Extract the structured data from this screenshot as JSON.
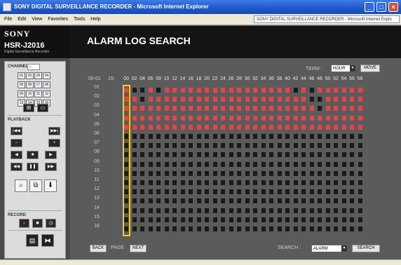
{
  "window": {
    "title": "SONY DIGITAL SURVEILLANCE RECORDER - Microsoft Internet Explorer",
    "url": "SONY DIGITAL SURVEILLANCE RECORDER - Microsoft Internet Explo"
  },
  "menu": [
    "File",
    "Edit",
    "View",
    "Favorites",
    "Tools",
    "Help"
  ],
  "brand": {
    "logo": "SONY",
    "model": "HSR-J2016",
    "subtitle": "Digital Surveillance Recorder"
  },
  "sidebar": {
    "channel_label": "CHANNEL",
    "channel_select": "--",
    "channels": [
      "01",
      "02",
      "03",
      "04",
      "05",
      "06",
      "07",
      "08",
      "09",
      "10",
      "11",
      "12",
      "13",
      "14",
      "15",
      "16"
    ],
    "active_channel": "07",
    "playback_label": "PLAYBACK",
    "record_label": "RECORD",
    "playback_buttons": [
      {
        "name": "skip-back-button",
        "glyph": "|◀◀"
      },
      {
        "name": "skip-forward-button",
        "glyph": "▶▶|"
      },
      {
        "name": "minus-button",
        "glyph": "−"
      },
      {
        "name": "plus-button",
        "glyph": "+"
      },
      {
        "name": "rewind-button",
        "glyph": "◀"
      },
      {
        "name": "stop-button",
        "glyph": "■"
      },
      {
        "name": "play-button",
        "glyph": "▶"
      },
      {
        "name": "fast-rewind-button",
        "glyph": "◀◀"
      },
      {
        "name": "pause-button",
        "glyph": "❚❚"
      },
      {
        "name": "fast-forward-button",
        "glyph": "▶▶"
      }
    ],
    "tool_icons": [
      {
        "name": "search-icon",
        "glyph": "⌕"
      },
      {
        "name": "copy-icon",
        "glyph": "⧉"
      },
      {
        "name": "download-icon",
        "glyph": "⬇"
      }
    ],
    "record_buttons": [
      {
        "name": "record-button",
        "glyph": "●"
      },
      {
        "name": "record-stop-button",
        "glyph": "■"
      },
      {
        "name": "timer-button",
        "glyph": "◷"
      }
    ],
    "menu_icons": [
      {
        "name": "log-list-icon",
        "glyph": "▤"
      },
      {
        "name": "network-icon",
        "glyph": "⧓"
      }
    ]
  },
  "header": {
    "page_title": "ALARM LOG SEARCH"
  },
  "controls": {
    "term_label": "TERM :",
    "term_value": "HOUR",
    "move_label": "MOVE",
    "back_label": "BACK",
    "page_label": "PAGE",
    "next_label": "NEXT",
    "search_label": "SEARCH :",
    "search_value": "ALARM",
    "search_button": "SEARCH"
  },
  "log": {
    "date": "06-01",
    "hour": "15:",
    "minutes": [
      "00",
      "02",
      "04",
      "06",
      "08",
      "10",
      "12",
      "14",
      "16",
      "18",
      "20",
      "22",
      "24",
      "26",
      "28",
      "30",
      "32",
      "34",
      "36",
      "38",
      "40",
      "42",
      "44",
      "46",
      "48",
      "50",
      "52",
      "54",
      "56",
      "58"
    ],
    "channels": [
      "01",
      "02",
      "03",
      "04",
      "05",
      "06",
      "07",
      "08",
      "09",
      "10",
      "11",
      "12",
      "13",
      "14",
      "15",
      "16"
    ],
    "selected_minute": "00",
    "alarm_rows": {
      "01": [
        1,
        0,
        0,
        1,
        0,
        1,
        1,
        1,
        1,
        1,
        1,
        1,
        1,
        1,
        1,
        1,
        1,
        1,
        1,
        1,
        1,
        0,
        1,
        0,
        1,
        1,
        1,
        1,
        1,
        1
      ],
      "02": [
        1,
        1,
        0,
        1,
        1,
        1,
        1,
        1,
        1,
        1,
        1,
        1,
        1,
        1,
        1,
        1,
        1,
        1,
        1,
        1,
        1,
        1,
        1,
        0,
        0,
        1,
        1,
        1,
        1,
        1
      ],
      "03": [
        1,
        1,
        1,
        1,
        1,
        1,
        1,
        1,
        1,
        1,
        1,
        1,
        1,
        1,
        1,
        1,
        1,
        1,
        1,
        1,
        1,
        1,
        1,
        1,
        0,
        1,
        1,
        1,
        1,
        1
      ],
      "04": [
        1,
        1,
        1,
        1,
        1,
        1,
        1,
        1,
        1,
        1,
        1,
        1,
        1,
        1,
        1,
        1,
        1,
        1,
        1,
        1,
        1,
        1,
        1,
        1,
        1,
        1,
        1,
        1,
        1,
        1
      ],
      "05": [
        1,
        1,
        1,
        1,
        1,
        1,
        1,
        1,
        1,
        1,
        1,
        1,
        1,
        1,
        1,
        1,
        1,
        1,
        1,
        1,
        1,
        1,
        1,
        1,
        1,
        1,
        1,
        1,
        1,
        1
      ]
    },
    "colors": {
      "alarm": "#e8424a",
      "none": "#1a1a1a",
      "selected": "#f2cc1e"
    }
  }
}
